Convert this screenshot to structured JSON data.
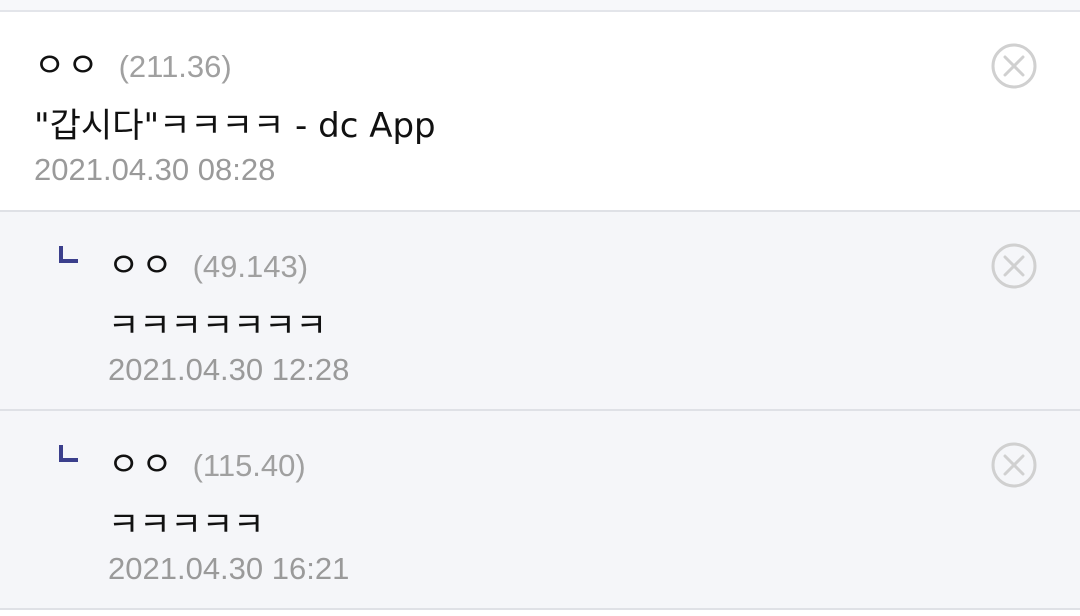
{
  "comments": [
    {
      "author": "ㅇㅇ",
      "ip": "(211.36)",
      "text": "\"갑시다\"ㅋㅋㅋㅋ - dc App",
      "date": "2021.04.30 08:28"
    },
    {
      "author": "ㅇㅇ",
      "ip": "(49.143)",
      "text": "ㅋㅋㅋㅋㅋㅋㅋ",
      "date": "2021.04.30 12:28"
    },
    {
      "author": "ㅇㅇ",
      "ip": "(115.40)",
      "text": "ㅋㅋㅋㅋㅋ",
      "date": "2021.04.30 16:21"
    }
  ],
  "icons": {
    "delete": "close-circle-icon",
    "reply": "reply-corner-icon"
  },
  "colors": {
    "reply_mark": "#3b3f8c",
    "reply_background": "#f5f6f9",
    "meta_gray": "#a0a0a0",
    "delete_icon": "#cfcfcf"
  }
}
